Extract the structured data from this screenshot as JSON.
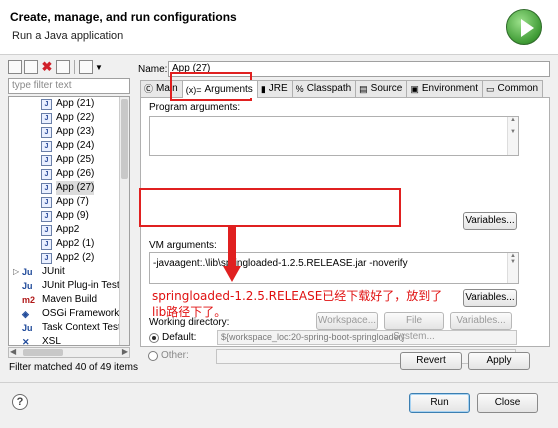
{
  "window": {
    "title": "Create, manage, and run configurations",
    "subtitle": "Run a Java application",
    "logo_icon": "run-play-icon"
  },
  "left_panel": {
    "toolbar_icons": [
      "new-config-icon",
      "new-prototype-icon",
      "delete-icon",
      "collapse-all-icon",
      "filter-icon",
      "dropdown-arrow-icon"
    ],
    "filter_placeholder": "type filter text",
    "tree_items": [
      {
        "label": "App (21)",
        "icon": "java-app-icon",
        "level": 1
      },
      {
        "label": "App (22)",
        "icon": "java-app-icon",
        "level": 1
      },
      {
        "label": "App (23)",
        "icon": "java-app-icon",
        "level": 1
      },
      {
        "label": "App (24)",
        "icon": "java-app-icon",
        "level": 1
      },
      {
        "label": "App (25)",
        "icon": "java-app-icon",
        "level": 1
      },
      {
        "label": "App (26)",
        "icon": "java-app-icon",
        "level": 1
      },
      {
        "label": "App (27)",
        "icon": "java-app-icon",
        "level": 1,
        "selected": true
      },
      {
        "label": "App (7)",
        "icon": "java-app-icon",
        "level": 1
      },
      {
        "label": "App (9)",
        "icon": "java-app-icon",
        "level": 1
      },
      {
        "label": "App2",
        "icon": "java-app-icon",
        "level": 1
      },
      {
        "label": "App2 (1)",
        "icon": "java-app-icon",
        "level": 1
      },
      {
        "label": "App2 (2)",
        "icon": "java-app-icon",
        "level": 1
      },
      {
        "label": "JUnit",
        "icon": "junit-icon",
        "level": 0,
        "expander": "▷",
        "glyph": "Ju"
      },
      {
        "label": "JUnit Plug-in Test",
        "icon": "junit-plugin-icon",
        "level": 0,
        "glyph": "Ju"
      },
      {
        "label": "Maven Build",
        "icon": "maven-icon",
        "level": 0,
        "glyph": "m2"
      },
      {
        "label": "OSGi Framework",
        "icon": "osgi-icon",
        "level": 0,
        "glyph": "◈"
      },
      {
        "label": "Task Context Test",
        "icon": "task-context-icon",
        "level": 0,
        "glyph": "Ju"
      },
      {
        "label": "XSL",
        "icon": "xsl-icon",
        "level": 0,
        "glyph": "✕"
      }
    ],
    "filter_status": "Filter matched 40 of 49 items"
  },
  "right_panel": {
    "name_label": "Name:",
    "name_value": "App (27)",
    "tabs": [
      {
        "label": "Main",
        "icon": "main-tab-icon",
        "glyph": "Ⓒ"
      },
      {
        "label": "Arguments",
        "icon": "arguments-tab-icon",
        "glyph": "(x)=",
        "active": true
      },
      {
        "label": "JRE",
        "icon": "jre-tab-icon",
        "glyph": "▮"
      },
      {
        "label": "Classpath",
        "icon": "classpath-tab-icon",
        "glyph": "%"
      },
      {
        "label": "Source",
        "icon": "source-tab-icon",
        "glyph": "▤"
      },
      {
        "label": "Environment",
        "icon": "environment-tab-icon",
        "glyph": "▣"
      },
      {
        "label": "Common",
        "icon": "common-tab-icon",
        "glyph": "▭"
      }
    ],
    "program_arguments_label": "Program arguments:",
    "program_arguments_value": "",
    "variables_label": "Variables...",
    "vm_arguments_label": "VM arguments:",
    "vm_arguments_value": "-javaagent:.\\lib\\springloaded-1.2.5.RELEASE.jar -noverify",
    "working_directory_label": "Working directory:",
    "default_label": "Default:",
    "default_value": "${workspace_loc:20-spring-boot-springloader}",
    "other_label": "Other:",
    "other_value": "",
    "workspace_label": "Workspace...",
    "file_system_label": "File System...",
    "variables_small_label": "Variables...",
    "revert_label": "Revert",
    "apply_label": "Apply"
  },
  "annotation": {
    "line1": "springloaded-1.2.5.RELEASE已经下载好了，放到了",
    "line2": "lib路径下了。",
    "color": "#e01010"
  },
  "footer": {
    "help_glyph": "?",
    "run_label": "Run",
    "close_label": "Close"
  },
  "colors": {
    "highlight": "#e02020",
    "dialog_bg": "#f0f0f0"
  }
}
